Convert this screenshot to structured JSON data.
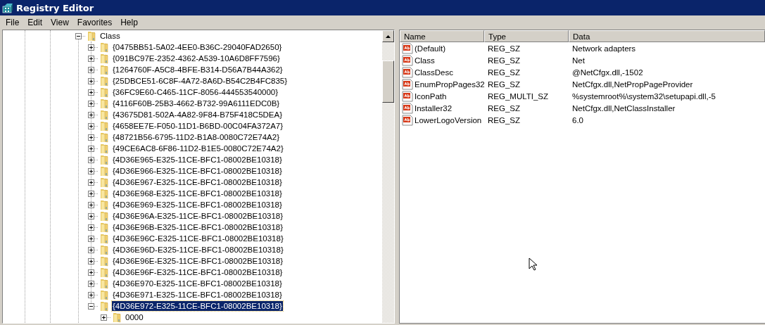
{
  "window": {
    "title": "Registry Editor"
  },
  "menu": [
    "File",
    "Edit",
    "View",
    "Favorites",
    "Help"
  ],
  "tree": [
    {
      "label": "Class",
      "expanded": true,
      "selected": false,
      "children": [
        {
          "label": "{0475BB51-5A02-4EE0-B36C-29040FAD2650}",
          "expanded": false,
          "selected": false
        },
        {
          "label": "{091BC97E-2352-4362-A539-10A6D8FF7596}",
          "expanded": false,
          "selected": false
        },
        {
          "label": "{1264760F-A5C8-4BFE-B314-D56A7B44A362}",
          "expanded": false,
          "selected": false
        },
        {
          "label": "{25DBCE51-6C8F-4A72-8A6D-B54C2B4FC835}",
          "expanded": false,
          "selected": false
        },
        {
          "label": "{36FC9E60-C465-11CF-8056-444553540000}",
          "expanded": false,
          "selected": false
        },
        {
          "label": "{4116F60B-25B3-4662-B732-99A6111EDC0B}",
          "expanded": false,
          "selected": false
        },
        {
          "label": "{43675D81-502A-4A82-9F84-B75F418C5DEA}",
          "expanded": false,
          "selected": false
        },
        {
          "label": "{4658EE7E-F050-11D1-B6BD-00C04FA372A7}",
          "expanded": false,
          "selected": false
        },
        {
          "label": "{48721B56-6795-11D2-B1A8-0080C72E74A2}",
          "expanded": false,
          "selected": false
        },
        {
          "label": "{49CE6AC8-6F86-11D2-B1E5-0080C72E74A2}",
          "expanded": false,
          "selected": false
        },
        {
          "label": "{4D36E965-E325-11CE-BFC1-08002BE10318}",
          "expanded": false,
          "selected": false
        },
        {
          "label": "{4D36E966-E325-11CE-BFC1-08002BE10318}",
          "expanded": false,
          "selected": false
        },
        {
          "label": "{4D36E967-E325-11CE-BFC1-08002BE10318}",
          "expanded": false,
          "selected": false
        },
        {
          "label": "{4D36E968-E325-11CE-BFC1-08002BE10318}",
          "expanded": false,
          "selected": false
        },
        {
          "label": "{4D36E969-E325-11CE-BFC1-08002BE10318}",
          "expanded": false,
          "selected": false
        },
        {
          "label": "{4D36E96A-E325-11CE-BFC1-08002BE10318}",
          "expanded": false,
          "selected": false
        },
        {
          "label": "{4D36E96B-E325-11CE-BFC1-08002BE10318}",
          "expanded": false,
          "selected": false
        },
        {
          "label": "{4D36E96C-E325-11CE-BFC1-08002BE10318}",
          "expanded": false,
          "selected": false
        },
        {
          "label": "{4D36E96D-E325-11CE-BFC1-08002BE10318}",
          "expanded": false,
          "selected": false
        },
        {
          "label": "{4D36E96E-E325-11CE-BFC1-08002BE10318}",
          "expanded": false,
          "selected": false
        },
        {
          "label": "{4D36E96F-E325-11CE-BFC1-08002BE10318}",
          "expanded": false,
          "selected": false
        },
        {
          "label": "{4D36E970-E325-11CE-BFC1-08002BE10318}",
          "expanded": false,
          "selected": false
        },
        {
          "label": "{4D36E971-E325-11CE-BFC1-08002BE10318}",
          "expanded": false,
          "selected": false
        },
        {
          "label": "{4D36E972-E325-11CE-BFC1-08002BE10318}",
          "expanded": true,
          "selected": true,
          "children": [
            {
              "label": "0000",
              "expanded": false,
              "selected": false
            }
          ]
        }
      ]
    }
  ],
  "values": {
    "columns": [
      "Name",
      "Type",
      "Data"
    ],
    "rows": [
      {
        "name": "(Default)",
        "type": "REG_SZ",
        "data": "Network adapters"
      },
      {
        "name": "Class",
        "type": "REG_SZ",
        "data": "Net"
      },
      {
        "name": "ClassDesc",
        "type": "REG_SZ",
        "data": "@NetCfgx.dll,-1502"
      },
      {
        "name": "EnumPropPages32",
        "type": "REG_SZ",
        "data": "NetCfgx.dll,NetPropPageProvider"
      },
      {
        "name": "IconPath",
        "type": "REG_MULTI_SZ",
        "data": "%systemroot%\\system32\\setupapi.dll,-5"
      },
      {
        "name": "Installer32",
        "type": "REG_SZ",
        "data": "NetCfgx.dll,NetClassInstaller"
      },
      {
        "name": "LowerLogoVersion",
        "type": "REG_SZ",
        "data": "6.0"
      }
    ]
  }
}
